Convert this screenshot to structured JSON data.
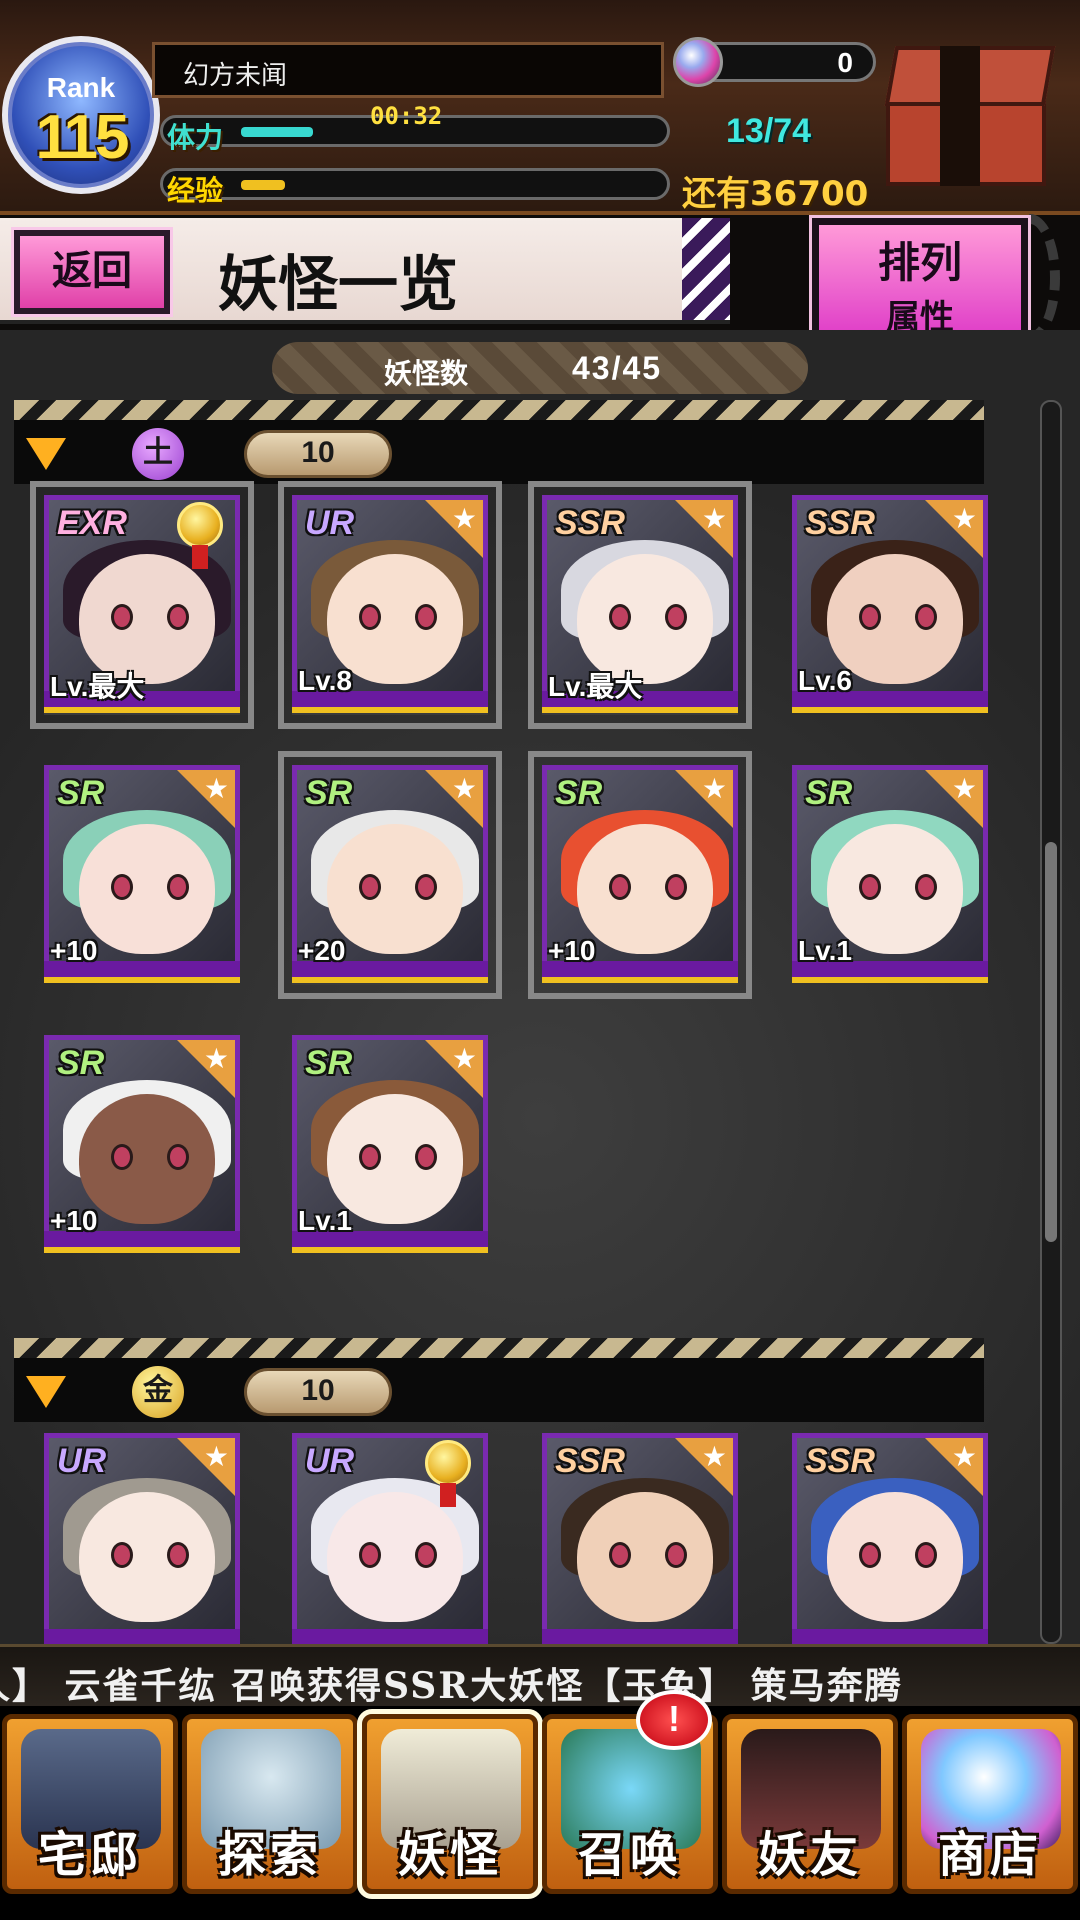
{
  "header": {
    "rank_label": "Rank",
    "rank_value": "115",
    "player_name": "幻方未闻",
    "stamina_icon": "体力",
    "stamina_timer": "00:32",
    "stamina_count": "13/74",
    "stamina_fill_fraction": 0.18,
    "exp_icon": "经验",
    "exp_remaining": "还有36700",
    "exp_fill_fraction": 0.11,
    "orb_count": "0"
  },
  "title_bar": {
    "back_label": "返回",
    "page_title": "妖怪一览",
    "sort_label": "排列",
    "sort_value": "属性"
  },
  "list": {
    "yokai_count_label": "妖怪数",
    "yokai_count_value": "43/45",
    "groups": [
      {
        "attribute_icon": "土",
        "count": "10",
        "cards": [
          {
            "rarity": "EXR",
            "level": "Lv.最大",
            "medal": true
          },
          {
            "rarity": "UR",
            "level": "Lv.8"
          },
          {
            "rarity": "SSR",
            "level": "Lv.最大"
          },
          {
            "rarity": "SSR",
            "level": "Lv.6"
          },
          {
            "rarity": "SR",
            "level": "+10"
          },
          {
            "rarity": "SR",
            "level": "+20"
          },
          {
            "rarity": "SR",
            "level": "+10"
          },
          {
            "rarity": "SR",
            "level": "Lv.1"
          },
          {
            "rarity": "SR",
            "level": "+10"
          },
          {
            "rarity": "SR",
            "level": "Lv.1"
          }
        ]
      },
      {
        "attribute_icon": "金",
        "count": "10",
        "cards": [
          {
            "rarity": "UR",
            "level": ""
          },
          {
            "rarity": "UR",
            "level": "",
            "medal": true
          },
          {
            "rarity": "SSR",
            "level": ""
          },
          {
            "rarity": "SSR",
            "level": ""
          }
        ]
      }
    ]
  },
  "ticker": {
    "text": "人】 云雀千纮 召唤获得SSR大妖怪【玉兔】 策马奔腾"
  },
  "nav": {
    "items": [
      {
        "label": "宅邸",
        "icon": "mansion-icon"
      },
      {
        "label": "探索",
        "icon": "magnifier-icon"
      },
      {
        "label": "妖怪",
        "icon": "scroll-icon"
      },
      {
        "label": "召唤",
        "icon": "pentagram-icon"
      },
      {
        "label": "妖友",
        "icon": "fox-girl-icon"
      },
      {
        "label": "商店",
        "icon": "orb-icon"
      }
    ],
    "summon_alert": "!"
  },
  "colors": {
    "accent_pink": "#e040a8",
    "stamina": "#38d8d0",
    "exp": "#f0c020"
  }
}
